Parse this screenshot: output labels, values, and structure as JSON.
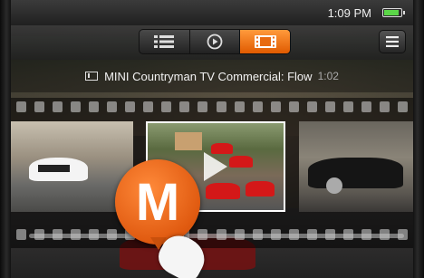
{
  "status_bar": {
    "time": "1:09 PM",
    "battery_level": 0.8,
    "battery_color": "#5bd648"
  },
  "toolbar": {
    "view_tabs": [
      {
        "icon": "list-icon",
        "active": false
      },
      {
        "icon": "play-circle-icon",
        "active": false
      },
      {
        "icon": "filmstrip-icon",
        "active": true
      }
    ],
    "menu_icon": "menu-icon",
    "accent_color": "#f07a20"
  },
  "video": {
    "title": "MINI Countryman TV Commercial: Flow",
    "duration": "1:02"
  },
  "filmstrip": {
    "frames": [
      "frame-white-car",
      "frame-red-cars-current",
      "frame-black-car"
    ],
    "current_index": 1
  },
  "scrubber": {
    "position": 0.4,
    "badge_letter": "M"
  }
}
